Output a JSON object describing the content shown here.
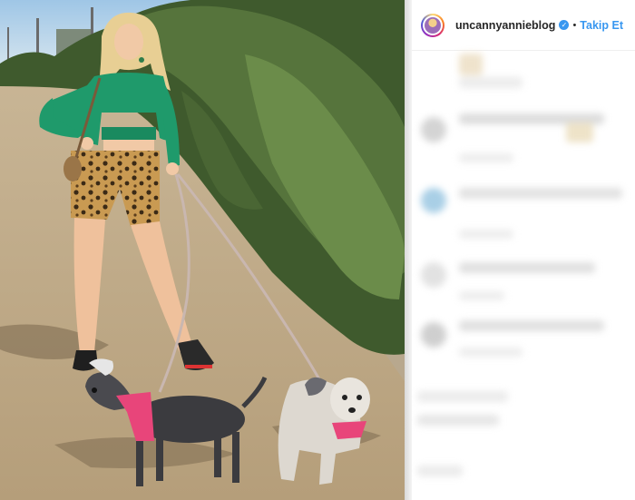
{
  "post": {
    "username": "uncannyannieblog",
    "verified_icon": "verified-badge-icon",
    "separator": "•",
    "follow_label": "Takip Et"
  },
  "colors": {
    "link_blue": "#3897f0",
    "text_dark": "#262626",
    "blur_gray": "#e6e6e6"
  }
}
